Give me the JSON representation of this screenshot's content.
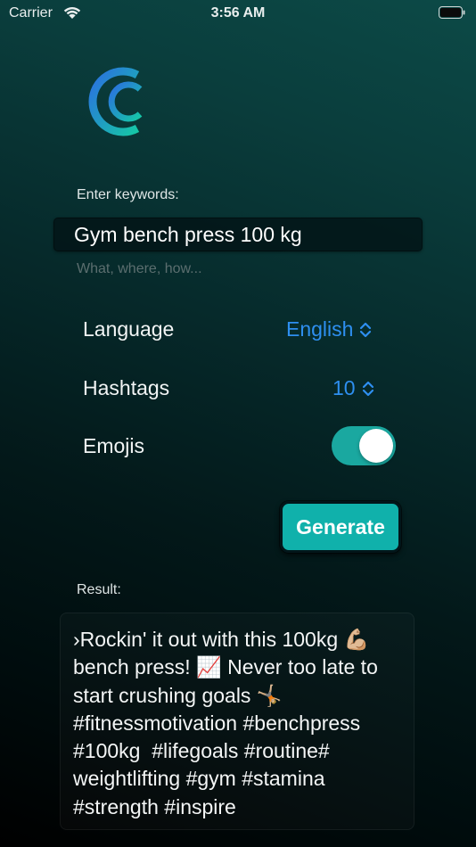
{
  "status_bar": {
    "carrier": "Carrier",
    "time": "3:56 AM"
  },
  "logo": {
    "icon": "app-logo-c-icon",
    "gradient_colors": [
      "#2b6fe0",
      "#16c7a6"
    ]
  },
  "form": {
    "keywords_label": "Enter keywords:",
    "keywords_value": "Gym bench press 100 kg",
    "keywords_hint": "What, where, how...",
    "language_label": "Language",
    "language_value": "English",
    "hashtags_label": "Hashtags",
    "hashtags_value": "10",
    "emojis_label": "Emojis",
    "emojis_enabled": true,
    "generate_label": "Generate"
  },
  "result": {
    "label": "Result:",
    "text": "›Rockin' it out with this 100kg 💪🏼 bench press! 📈 Never too late to start crushing goals 🤸🏼\n#fitnessmotivation #benchpress\n#100kg  #lifegoals #routine#\nweightlifting #gym #stamina\n#strength #inspire"
  },
  "colors": {
    "accent_blue": "#2e8ff0",
    "toggle_on": "#1aa8a0",
    "generate_button": "#10b1ab"
  }
}
